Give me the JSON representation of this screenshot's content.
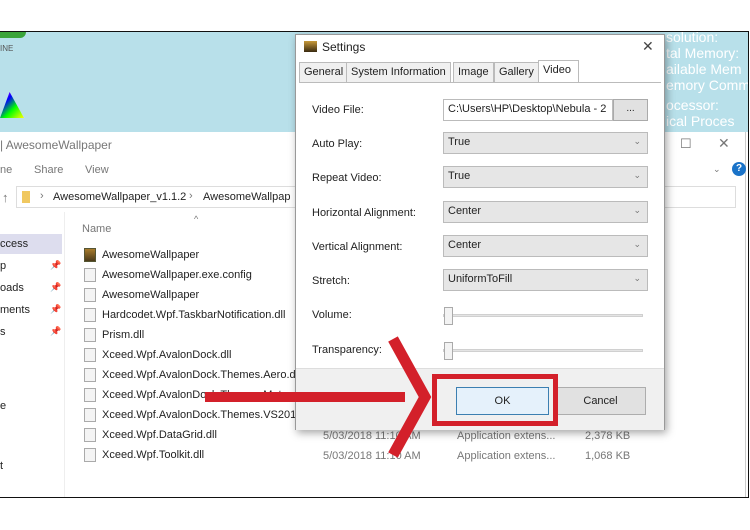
{
  "wallpaper": {
    "tag_text": "INE",
    "sysinfo_lines": [
      "solution:",
      "tal Memory:",
      "ailable Mem",
      "emory Comm",
      "",
      "ocessor:",
      "ical Proces"
    ]
  },
  "explorer": {
    "title": "AwesomeWallpaper",
    "ribbon_tabs": [
      "ne",
      "Share",
      "View"
    ],
    "breadcrumb": [
      "AwesomeWallpaper_v1.1.2",
      "AwesomeWallpap"
    ],
    "column_name": "Name",
    "nav_items": [
      "ccess",
      "p",
      "oads",
      "ments",
      "s",
      "e",
      "t"
    ],
    "files": [
      {
        "name": "AwesomeWallpaper",
        "icon": "app-icon",
        "date": "",
        "type": "",
        "size": ""
      },
      {
        "name": "AwesomeWallpaper.exe.config",
        "icon": "file-icon",
        "date": "",
        "type": "",
        "size": ""
      },
      {
        "name": "AwesomeWallpaper",
        "icon": "file-icon",
        "date": "",
        "type": "",
        "size": ""
      },
      {
        "name": "Hardcodet.Wpf.TaskbarNotification.dll",
        "icon": "dll-icon",
        "date": "",
        "type": "",
        "size": ""
      },
      {
        "name": "Prism.dll",
        "icon": "dll-icon",
        "date": "",
        "type": "",
        "size": ""
      },
      {
        "name": "Xceed.Wpf.AvalonDock.dll",
        "icon": "dll-icon",
        "date": "",
        "type": "",
        "size": ""
      },
      {
        "name": "Xceed.Wpf.AvalonDock.Themes.Aero.dl",
        "icon": "dll-icon",
        "date": "",
        "type": "",
        "size": ""
      },
      {
        "name": "Xceed.Wpf.AvalonDock.Themes.Metro.c",
        "icon": "dll-icon",
        "date": "",
        "type": "",
        "size": ""
      },
      {
        "name": "Xceed.Wpf.AvalonDock.Themes.VS2010",
        "icon": "dll-icon",
        "date": "",
        "type": "",
        "size": ""
      },
      {
        "name": "Xceed.Wpf.DataGrid.dll",
        "icon": "dll-icon",
        "date": "5/03/2018 11:10 AM",
        "type": "Application extens...",
        "size": "2,378 KB"
      },
      {
        "name": "Xceed.Wpf.Toolkit.dll",
        "icon": "dll-icon",
        "date": "5/03/2018 11:10 AM",
        "type": "Application extens...",
        "size": "1,068 KB"
      }
    ]
  },
  "dialog": {
    "title": "Settings",
    "tabs": [
      "General",
      "System Information",
      "Image",
      "Gallery",
      "Video"
    ],
    "active_tab": "Video",
    "fields": {
      "video_file": {
        "label": "Video File:",
        "value": "C:\\Users\\HP\\Desktop\\Nebula - 2",
        "browse": "..."
      },
      "auto_play": {
        "label": "Auto Play:",
        "value": "True"
      },
      "repeat_video": {
        "label": "Repeat Video:",
        "value": "True"
      },
      "horizontal_alignment": {
        "label": "Horizontal Alignment:",
        "value": "Center"
      },
      "vertical_alignment": {
        "label": "Vertical Alignment:",
        "value": "Center"
      },
      "stretch": {
        "label": "Stretch:",
        "value": "UniformToFill"
      },
      "volume": {
        "label": "Volume:",
        "value": 0
      },
      "transparency": {
        "label": "Transparency:",
        "value": 0
      }
    },
    "ok": "OK",
    "cancel": "Cancel"
  },
  "colors": {
    "annotation": "#d3202a",
    "wallpaper": "#b8e0ea"
  }
}
